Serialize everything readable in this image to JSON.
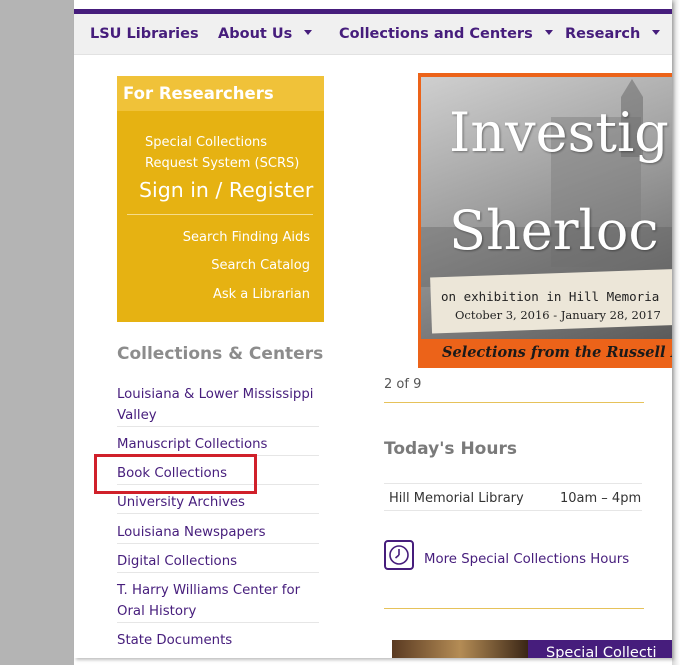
{
  "nav": {
    "items": [
      {
        "label": "LSU Libraries",
        "has_dropdown": false
      },
      {
        "label": "About Us",
        "has_dropdown": true
      },
      {
        "label": "Collections and Centers",
        "has_dropdown": true
      },
      {
        "label": "Research",
        "has_dropdown": true
      }
    ]
  },
  "researchers": {
    "heading": "For Researchers",
    "scrs_label": "Special Collections Request System (SCRS)",
    "sign_in_label": "Sign in / Register",
    "links": [
      "Search Finding Aids",
      "Search Catalog",
      "Ask a Librarian"
    ]
  },
  "collections": {
    "heading": "Collections & Centers",
    "items": [
      "Louisiana & Lower Mississippi Valley",
      "Manuscript Collections",
      "Book Collections",
      "University Archives",
      "Louisiana Newspapers",
      "Digital Collections",
      "T. Harry Williams Center for Oral History",
      "State Documents"
    ],
    "highlighted_item": "Book Collections"
  },
  "slideshow": {
    "title_line1": "Investig",
    "title_line2": "Sherloc",
    "exhibit_line": "on exhibition in Hill Memoria",
    "dates": "October 3, 2016 - January 28, 2017",
    "caption": "Selections from the Russell M",
    "counter": "2 of 9"
  },
  "hours": {
    "heading": "Today's Hours",
    "library": "Hill Memorial Library",
    "time": "10am – 4pm",
    "more_label": "More Special Collections Hours"
  },
  "teaser": {
    "label": "Special Collecti"
  },
  "colors": {
    "lsu_purple": "#461d7c",
    "lsu_gold": "#e6b212",
    "gold_light": "#f0c239",
    "slide_orange": "#ec6319",
    "highlight_red": "#d0202a"
  }
}
